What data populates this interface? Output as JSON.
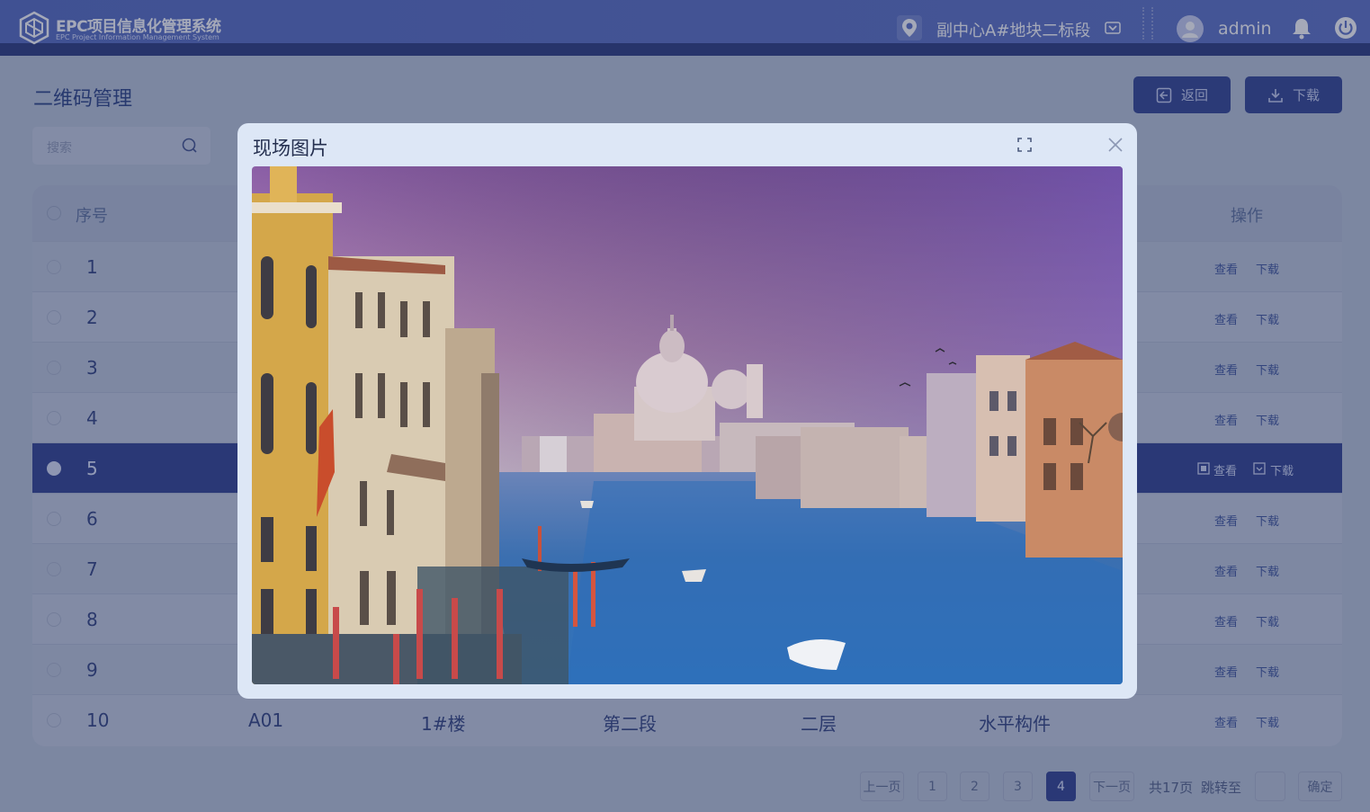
{
  "header": {
    "brand_title": "EPC项目信息化管理系统",
    "brand_subtitle": "EPC Project Information Management System",
    "location": "副中心A#地块二标段",
    "username": "admin"
  },
  "page": {
    "title": "二维码管理",
    "back_label": "返回",
    "download_label": "下载",
    "search_placeholder": "搜索"
  },
  "table": {
    "col_index": "序号",
    "col_actions": "操作",
    "view_label": "查看",
    "download_label": "下载",
    "rows": [
      {
        "index": "1"
      },
      {
        "index": "2"
      },
      {
        "index": "3"
      },
      {
        "index": "4"
      },
      {
        "index": "5"
      },
      {
        "index": "6"
      },
      {
        "index": "7"
      },
      {
        "index": "8"
      },
      {
        "index": "9"
      },
      {
        "index": "10",
        "code": "A01",
        "building": "1#楼",
        "section": "第二段",
        "floor": "二层",
        "component": "水平构件"
      }
    ],
    "selected_index": "5"
  },
  "pagination": {
    "prev": "上一页",
    "pages": [
      "1",
      "2",
      "3",
      "4"
    ],
    "current": "4",
    "next": "下一页",
    "total": "共17页",
    "jump_to": "跳转至",
    "confirm": "确定"
  },
  "modal": {
    "title": "现场图片"
  },
  "colors": {
    "header_bg": "#5268c0",
    "accent": "#2c3d8e",
    "modal_bg": "#dde7f6"
  }
}
